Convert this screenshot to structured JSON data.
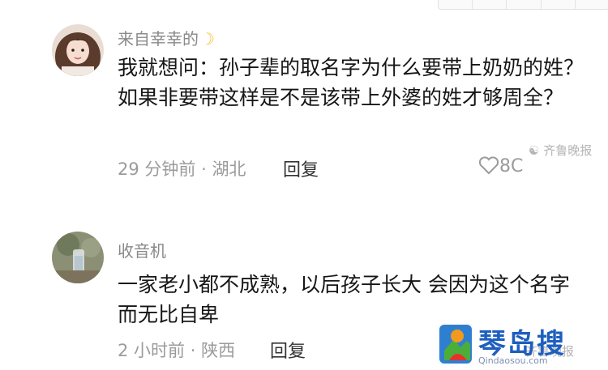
{
  "comments": [
    {
      "username": "来自幸幸的",
      "badge_icon": "moon-icon",
      "text": "我就想问：孙子辈的取名字为什么要带上奶奶的姓？如果非要带这样是不是该带上外婆的姓才够周全？",
      "time": "29 分钟前",
      "location": "湖北",
      "reply_label": "回复",
      "like_count": "8C"
    },
    {
      "username": "收音机",
      "text": "一家老小都不成熟，以后孩子长大 会因为这个名字而无比自卑",
      "time": "2 小时前",
      "location": "陕西",
      "reply_label": "回复"
    }
  ],
  "watermark": {
    "text": "齐鲁晚报"
  },
  "site_logo": {
    "name": "琴岛搜",
    "url": "Qindaosou.com"
  },
  "colors": {
    "meta": "#9b9b9b",
    "text": "#161616",
    "logo": "#1d5fbf"
  }
}
